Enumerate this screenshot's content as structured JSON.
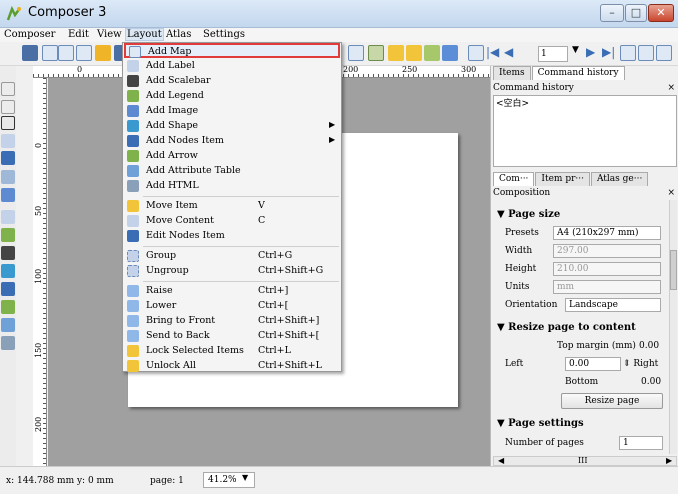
{
  "window": {
    "title": "Composer 3",
    "minimize_label": "–",
    "restore_label": "□",
    "close_label": "✕"
  },
  "menubar": [
    "Composer",
    "Edit",
    "View",
    "Layout",
    "Atlas",
    "Settings"
  ],
  "toolbar": {
    "page_field": "1"
  },
  "ruler": {
    "h_ticks": [
      "0",
      "200",
      "250",
      "300"
    ],
    "v_ticks": [
      "0",
      "50",
      "100",
      "150",
      "200"
    ]
  },
  "layout_menu": {
    "items": [
      {
        "label": "Add Map",
        "shortcut": "",
        "submenu": false,
        "icon": "map-icon"
      },
      {
        "label": "Add Label",
        "shortcut": "",
        "submenu": false,
        "icon": "label-icon"
      },
      {
        "label": "Add Scalebar",
        "shortcut": "",
        "submenu": false,
        "icon": "scalebar-icon"
      },
      {
        "label": "Add Legend",
        "shortcut": "",
        "submenu": false,
        "icon": "legend-icon"
      },
      {
        "label": "Add Image",
        "shortcut": "",
        "submenu": false,
        "icon": "image-icon"
      },
      {
        "label": "Add Shape",
        "shortcut": "",
        "submenu": true,
        "icon": "shape-icon"
      },
      {
        "label": "Add Nodes Item",
        "shortcut": "",
        "submenu": true,
        "icon": "nodes-icon"
      },
      {
        "label": "Add Arrow",
        "shortcut": "",
        "submenu": false,
        "icon": "arrow-icon"
      },
      {
        "label": "Add Attribute Table",
        "shortcut": "",
        "submenu": false,
        "icon": "table-icon"
      },
      {
        "label": "Add HTML",
        "shortcut": "",
        "submenu": false,
        "icon": "html-icon"
      },
      {
        "label": "Move Item",
        "shortcut": "V",
        "submenu": false,
        "icon": "move-item-icon"
      },
      {
        "label": "Move Content",
        "shortcut": "C",
        "submenu": false,
        "icon": "move-content-icon"
      },
      {
        "label": "Edit Nodes Item",
        "shortcut": "",
        "submenu": false,
        "icon": "edit-nodes-icon"
      },
      {
        "label": "Group",
        "shortcut": "Ctrl+G",
        "submenu": false,
        "icon": "group-icon"
      },
      {
        "label": "Ungroup",
        "shortcut": "Ctrl+Shift+G",
        "submenu": false,
        "icon": "ungroup-icon"
      },
      {
        "label": "Raise",
        "shortcut": "Ctrl+]",
        "submenu": false,
        "icon": "raise-icon"
      },
      {
        "label": "Lower",
        "shortcut": "Ctrl+[",
        "submenu": false,
        "icon": "lower-icon"
      },
      {
        "label": "Bring to Front",
        "shortcut": "Ctrl+Shift+]",
        "submenu": false,
        "icon": "bring-front-icon"
      },
      {
        "label": "Send to Back",
        "shortcut": "Ctrl+Shift+[",
        "submenu": false,
        "icon": "send-back-icon"
      },
      {
        "label": "Lock Selected Items",
        "shortcut": "Ctrl+L",
        "submenu": false,
        "icon": "lock-icon"
      },
      {
        "label": "Unlock All",
        "shortcut": "Ctrl+Shift+L",
        "submenu": false,
        "icon": "unlock-icon"
      }
    ]
  },
  "right_panel": {
    "top_tabs": [
      "Items",
      "Command history"
    ],
    "command_history_title": "Command history",
    "command_history_entry": "<空白>",
    "bottom_tabs": [
      "Com···",
      "Item pr···",
      "Atlas ge···"
    ],
    "composition_title": "Composition",
    "page_size": {
      "heading": "Page size",
      "presets_label": "Presets",
      "presets_value": "A4 (210x297 mm)",
      "width_label": "Width",
      "width_value": "297.00",
      "height_label": "Height",
      "height_value": "210.00",
      "units_label": "Units",
      "units_value": "mm",
      "orientation_label": "Orientation",
      "orientation_value": "Landscape"
    },
    "resize": {
      "heading": "Resize page to content",
      "top_margin_label": "Top margin (mm)",
      "top_margin_value": "0.00",
      "left_label": "Left",
      "left_value": "0.00",
      "right_label": "Right",
      "bottom_label": "Bottom",
      "bottom_value": "0.00",
      "button_label": "Resize page"
    },
    "page_settings": {
      "heading": "Page settings",
      "num_pages_label": "Number of pages",
      "num_pages_value": "1"
    },
    "hscroll_label": "III"
  },
  "status": {
    "coords": "x: 144.788 mm y: 0 mm",
    "page": "page: 1",
    "zoom": "41.2%"
  },
  "colors": {
    "canvas_bg": "#a0a0a0",
    "highlight_border": "#e23b3b"
  }
}
